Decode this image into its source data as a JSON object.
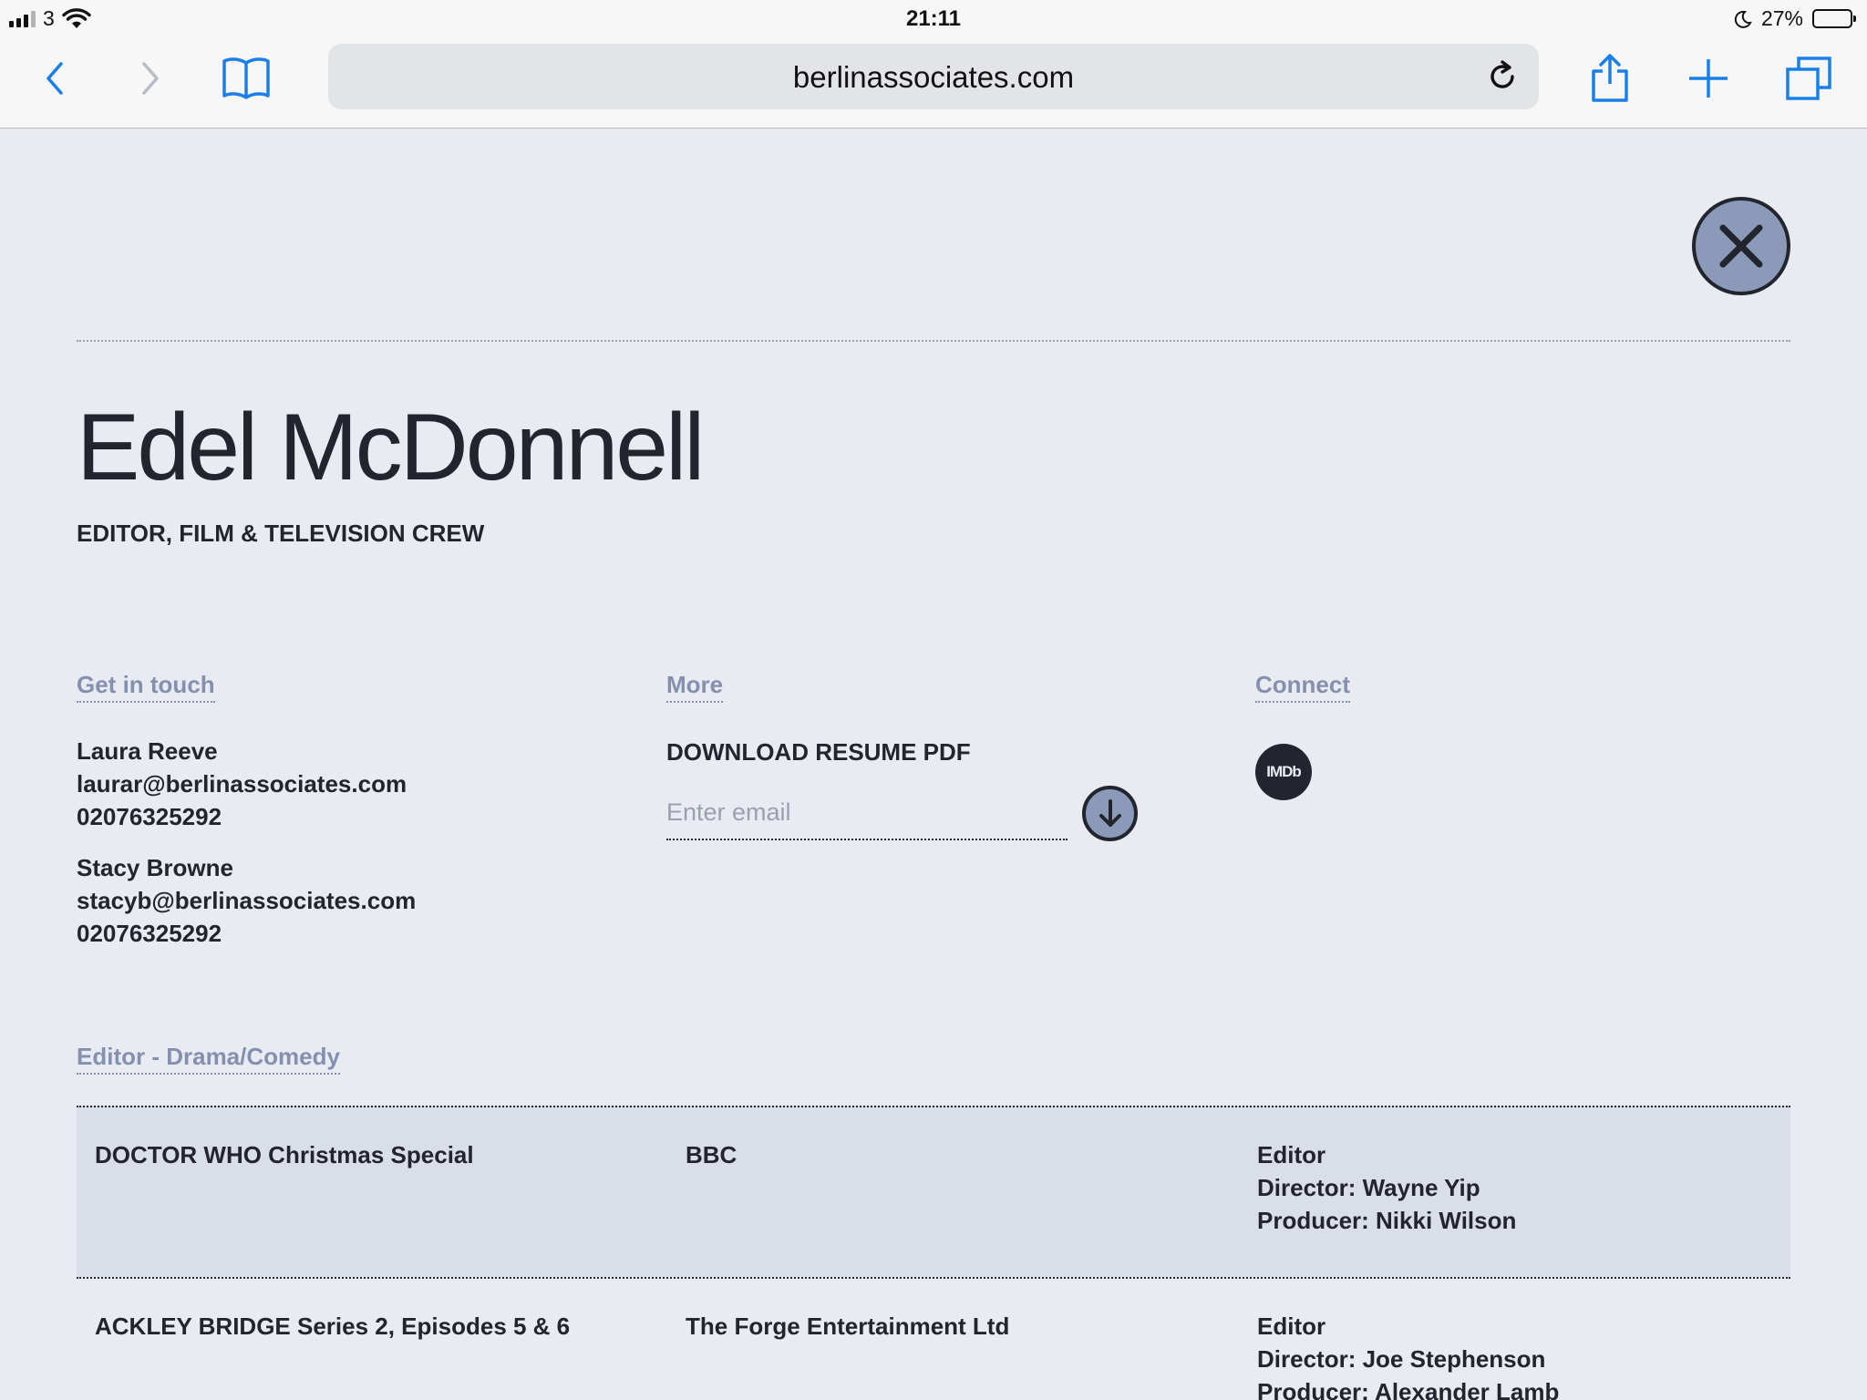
{
  "status_bar": {
    "carrier": "3",
    "time": "21:11",
    "battery": "27%",
    "battery_level": 0.27
  },
  "browser": {
    "url": "berlinassociates.com",
    "icons": [
      "back-icon",
      "forward-icon",
      "bookmarks-icon",
      "reload-icon",
      "share-icon",
      "add-tab-icon",
      "tabs-icon"
    ]
  },
  "profile": {
    "name": "Edel McDonnell",
    "subtitle": "EDITOR, FILM & TELEVISION CREW"
  },
  "get_in_touch": {
    "heading": "Get in touch",
    "contacts": [
      {
        "name": "Laura Reeve",
        "email": "laurar@berlinassociates.com",
        "phone": "02076325292"
      },
      {
        "name": "Stacy Browne",
        "email": "stacyb@berlinassociates.com",
        "phone": "02076325292"
      }
    ]
  },
  "more": {
    "heading": "More",
    "download_label": "DOWNLOAD RESUME PDF",
    "email_placeholder": "Enter email"
  },
  "connect": {
    "heading": "Connect",
    "imdb_label": "IMDb"
  },
  "credits_section": {
    "heading": "Editor - Drama/Comedy",
    "rows": [
      {
        "title": "DOCTOR WHO Christmas Special",
        "company": "BBC",
        "role": "Editor",
        "director": "Director: Wayne Yip",
        "producer": "Producer: Nikki Wilson"
      },
      {
        "title": "ACKLEY BRIDGE Series 2, Episodes 5 & 6",
        "company": "The Forge Entertainment Ltd",
        "role": "Editor",
        "director": "Director: Joe Stephenson",
        "producer": "Producer: Alexander Lamb"
      }
    ]
  },
  "colors": {
    "page_background": "#e8ebf2",
    "text_dark": "#23252e",
    "accent_muted": "#8590ae",
    "button_fill": "#8a9ab8",
    "row_shade": "#dadee8",
    "browser_blue": "#1a7fe8"
  }
}
